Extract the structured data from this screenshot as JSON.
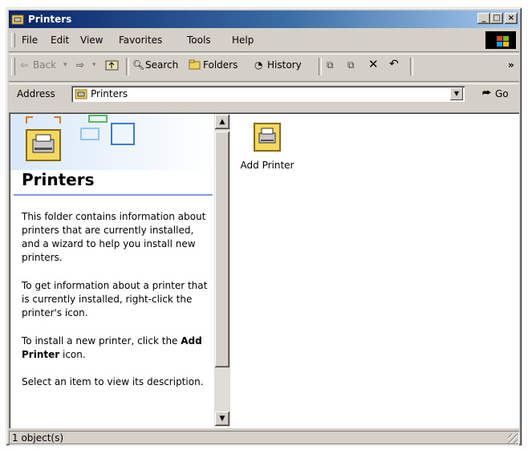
{
  "window": {
    "title": "Printers"
  },
  "caption_buttons": {
    "minimize": "_",
    "maximize": "□",
    "close": "×"
  },
  "menu": [
    "File",
    "Edit",
    "View",
    "Favorites",
    "Tools",
    "Help"
  ],
  "toolbar": {
    "back": "Back",
    "search": "Search",
    "folders": "Folders",
    "history": "History",
    "more": "»"
  },
  "address": {
    "label": "Address",
    "value": "Printers",
    "go": "Go"
  },
  "left_pane": {
    "title": "Printers",
    "paragraph1": "This folder contains information about printers that are currently installed, and a wizard to help you install new printers.",
    "paragraph2": "To get information about a printer that is currently installed, right-click the printer's icon.",
    "paragraph3_prefix": "To install a new printer, click the",
    "paragraph3_bold": "Add Printer",
    "paragraph3_suffix": "icon.",
    "paragraph4": "Select an item to view its description."
  },
  "items": [
    {
      "label": "Add Printer",
      "icon": "printer-icon"
    }
  ],
  "status": {
    "text": "1 object(s)"
  }
}
